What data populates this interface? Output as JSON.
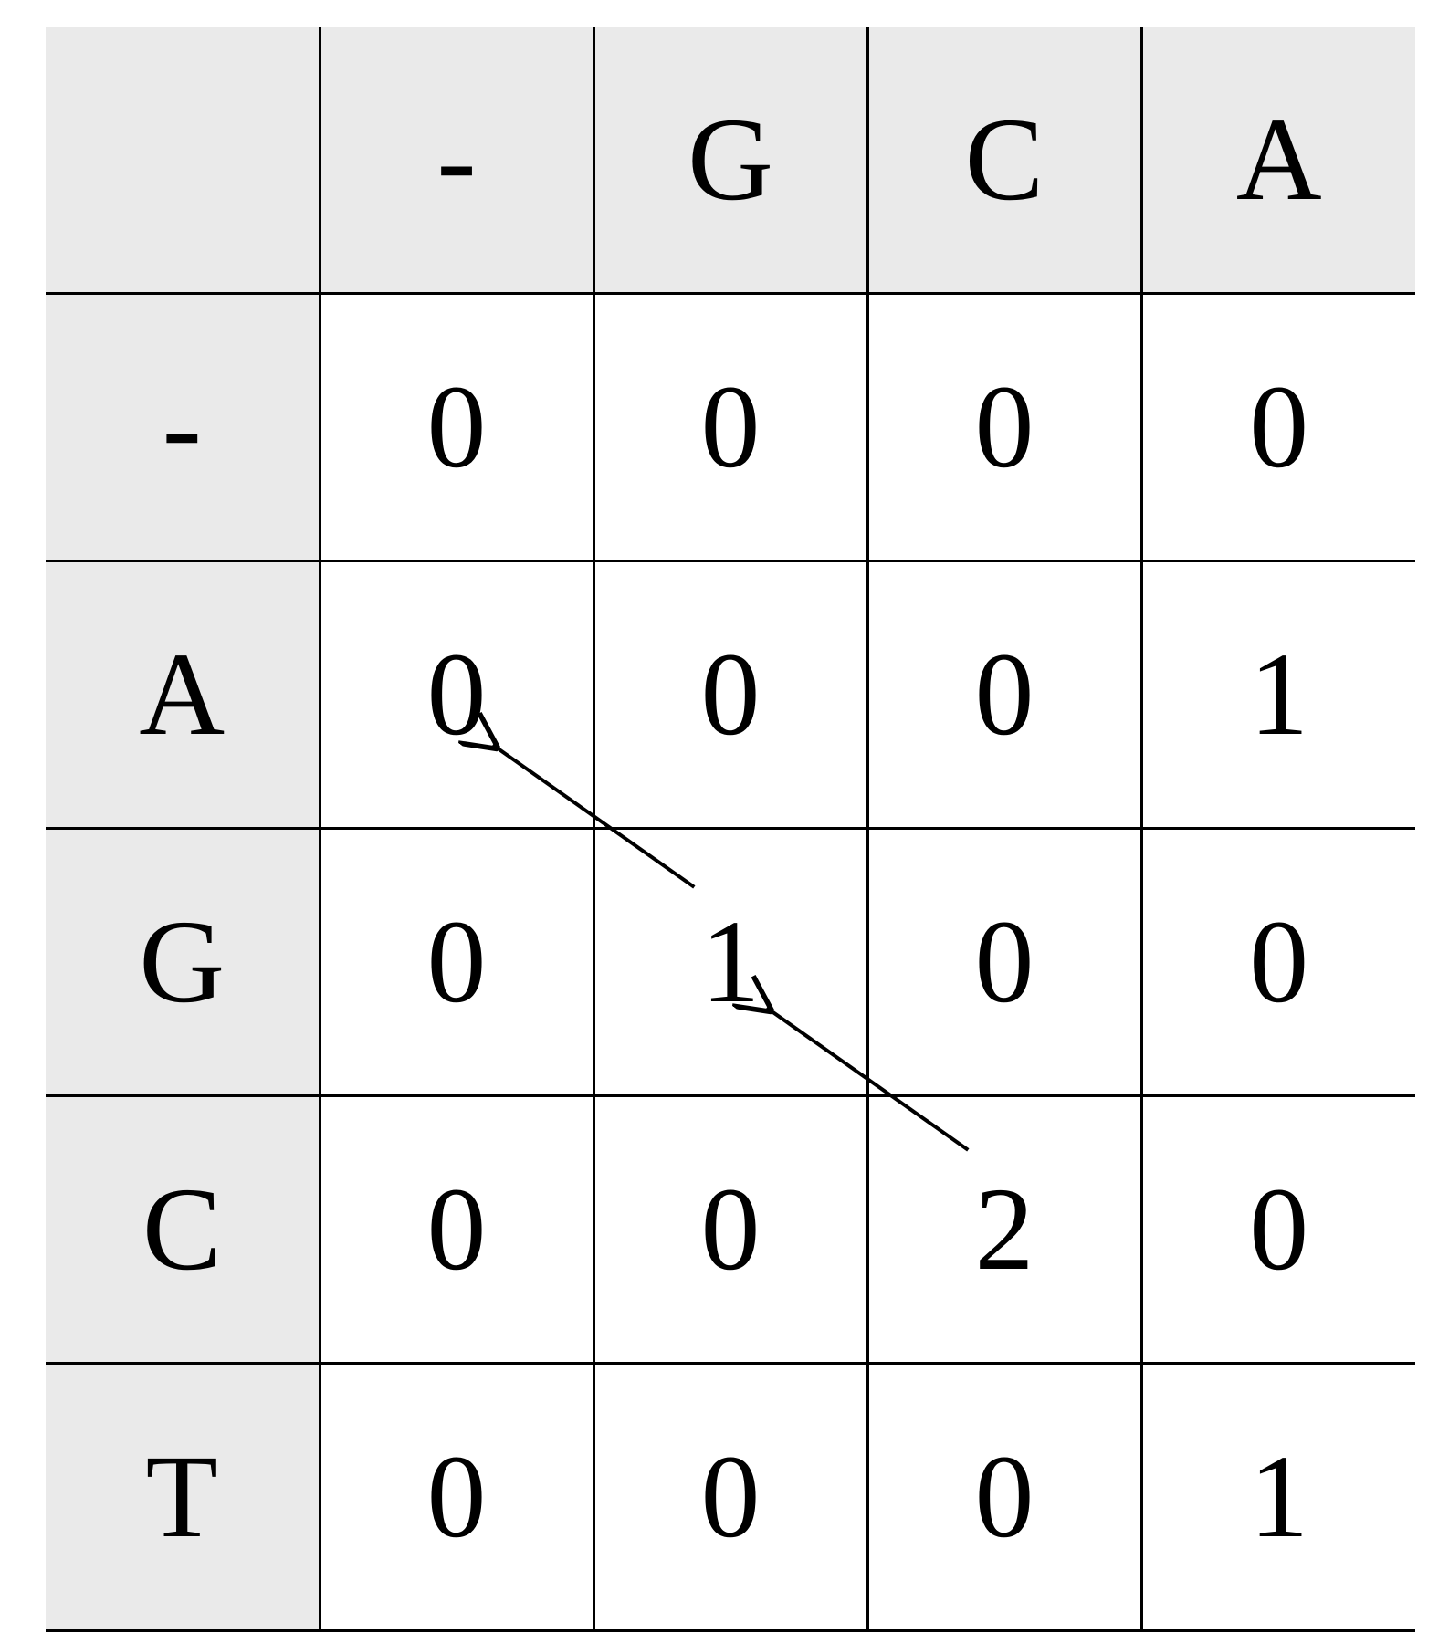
{
  "chart_data": {
    "type": "table",
    "title": "",
    "description": "Local alignment dynamic-programming score matrix with traceback arrows",
    "col_headers": [
      "",
      "-",
      "G",
      "C",
      "A"
    ],
    "row_headers": [
      "-",
      "A",
      "G",
      "C",
      "T"
    ],
    "cells": [
      [
        "0",
        "0",
        "0",
        "0"
      ],
      [
        "0",
        "0",
        "0",
        "1"
      ],
      [
        "0",
        "1",
        "0",
        "0"
      ],
      [
        "0",
        "0",
        "2",
        "0"
      ],
      [
        "0",
        "0",
        "0",
        "1"
      ]
    ],
    "traceback": [
      {
        "from_row": 4,
        "from_col": 3,
        "to_row": 3,
        "to_col": 2
      },
      {
        "from_row": 3,
        "from_col": 2,
        "to_row": 2,
        "to_col": 1
      }
    ]
  }
}
